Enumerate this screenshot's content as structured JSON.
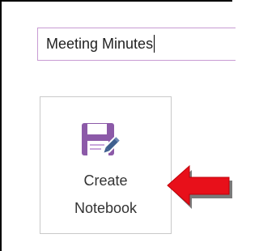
{
  "notebook_name_input": {
    "value": "Meeting Minutes"
  },
  "create_notebook_button": {
    "label_line1": "Create",
    "label_line2": "Notebook",
    "icon": "notebook-save-pencil-icon"
  },
  "annotation": {
    "icon": "red-arrow-icon"
  },
  "colors": {
    "accent_purple": "#8c5aa8",
    "input_border": "#c89bd3",
    "arrow_red": "#e8101a"
  }
}
